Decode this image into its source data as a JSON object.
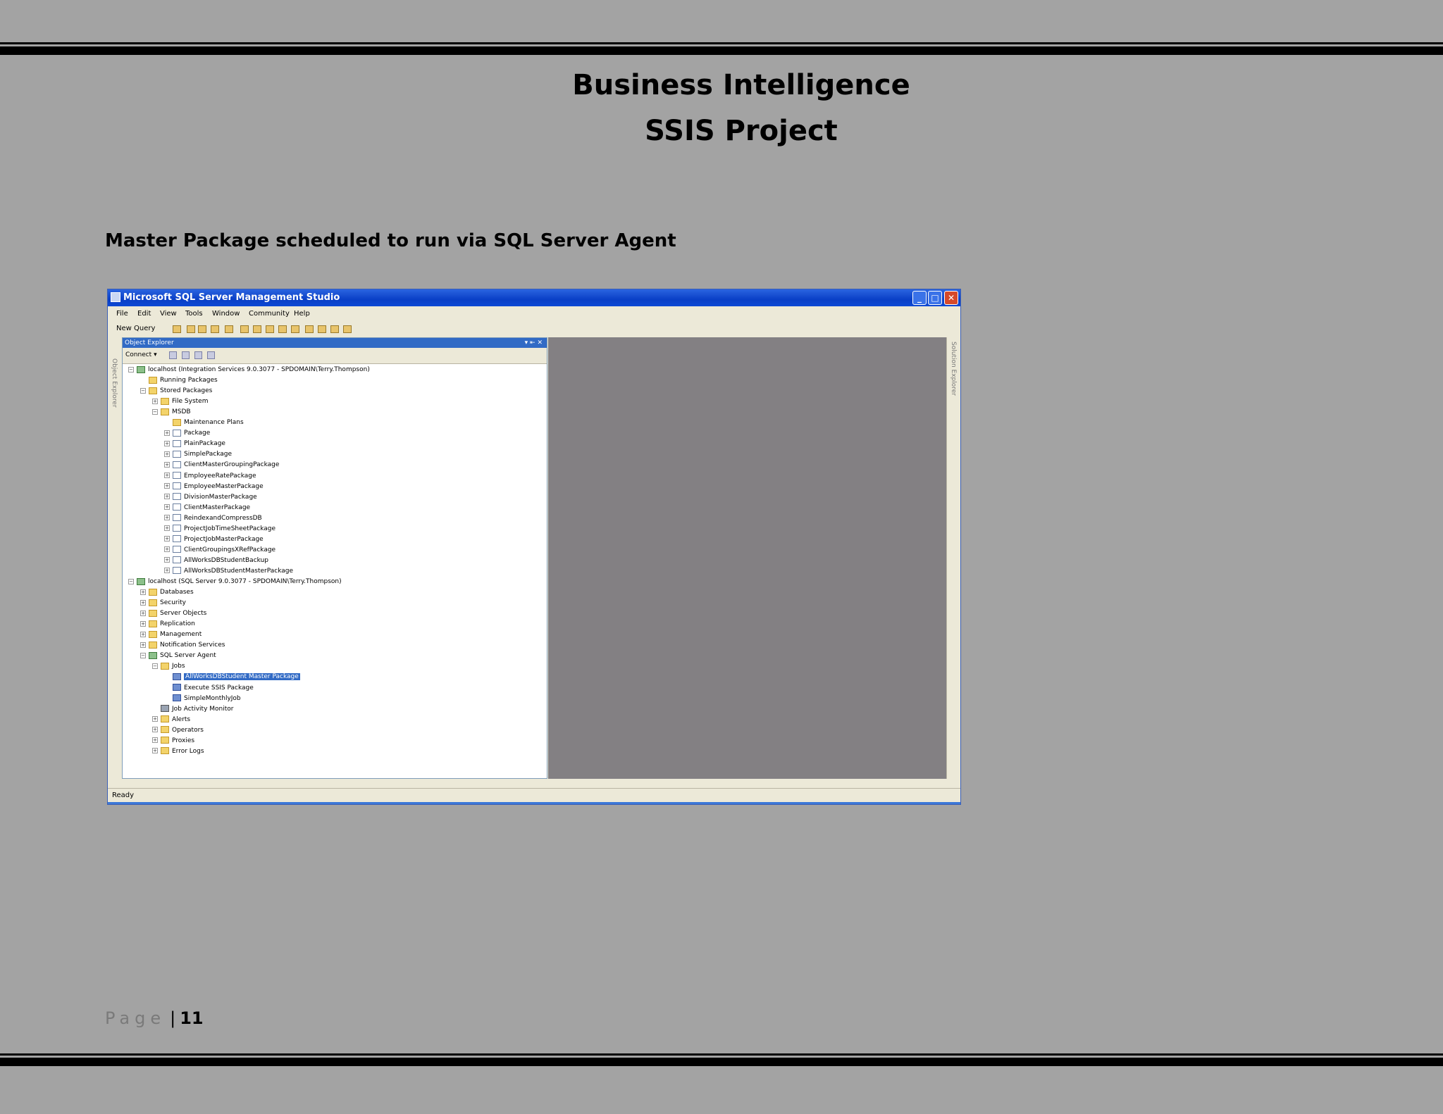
{
  "header": {
    "title_line1": "Business Intelligence",
    "title_line2": "SSIS Project"
  },
  "caption": "Master Package scheduled to run via SQL Server Agent",
  "screenshot": {
    "window_title": "Microsoft SQL Server Management Studio",
    "menu": [
      "File",
      "Edit",
      "View",
      "Tools",
      "Window",
      "Community",
      "Help"
    ],
    "toolbar_new_query": "New Query",
    "object_explorer": {
      "title": "Object Explorer",
      "connect": "Connect ▾",
      "strip_label": "Object Explorer"
    },
    "solution_explorer_label": "Solution Explorer",
    "tree": [
      {
        "label": "localhost (Integration Services 9.0.3077 - SPDOMAIN\\Terry.Thompson)",
        "icon": "server",
        "exp": "-",
        "selected": false
      },
      {
        "label": "Running Packages",
        "icon": "folder",
        "exp": "",
        "selected": false
      },
      {
        "label": "Stored Packages",
        "icon": "folder",
        "exp": "-",
        "selected": false
      },
      {
        "label": "File System",
        "icon": "folder",
        "exp": "+",
        "selected": false
      },
      {
        "label": "MSDB",
        "icon": "folder",
        "exp": "-",
        "selected": false
      },
      {
        "label": "Maintenance Plans",
        "icon": "folder",
        "exp": "",
        "selected": false
      },
      {
        "label": "Package",
        "icon": "pkg",
        "exp": "+",
        "selected": false
      },
      {
        "label": "PlainPackage",
        "icon": "pkg",
        "exp": "+",
        "selected": false
      },
      {
        "label": "SimplePackage",
        "icon": "pkg",
        "exp": "+",
        "selected": false
      },
      {
        "label": "ClientMasterGroupingPackage",
        "icon": "pkg",
        "exp": "+",
        "selected": false
      },
      {
        "label": "EmployeeRatePackage",
        "icon": "pkg",
        "exp": "+",
        "selected": false
      },
      {
        "label": "EmployeeMasterPackage",
        "icon": "pkg",
        "exp": "+",
        "selected": false
      },
      {
        "label": "DivisionMasterPackage",
        "icon": "pkg",
        "exp": "+",
        "selected": false
      },
      {
        "label": "ClientMasterPackage",
        "icon": "pkg",
        "exp": "+",
        "selected": false
      },
      {
        "label": "ReindexandCompressDB",
        "icon": "pkg",
        "exp": "+",
        "selected": false
      },
      {
        "label": "ProjectJobTimeSheetPackage",
        "icon": "pkg",
        "exp": "+",
        "selected": false
      },
      {
        "label": "ProjectJobMasterPackage",
        "icon": "pkg",
        "exp": "+",
        "selected": false
      },
      {
        "label": "ClientGroupingsXRefPackage",
        "icon": "pkg",
        "exp": "+",
        "selected": false
      },
      {
        "label": "AllWorksDBStudentBackup",
        "icon": "pkg",
        "exp": "+",
        "selected": false
      },
      {
        "label": "AllWorksDBStudentMasterPackage",
        "icon": "pkg",
        "exp": "+",
        "selected": false
      },
      {
        "label": "localhost (SQL Server 9.0.3077 - SPDOMAIN\\Terry.Thompson)",
        "icon": "server",
        "exp": "-",
        "selected": false
      },
      {
        "label": "Databases",
        "icon": "folder",
        "exp": "+",
        "selected": false
      },
      {
        "label": "Security",
        "icon": "folder",
        "exp": "+",
        "selected": false
      },
      {
        "label": "Server Objects",
        "icon": "folder",
        "exp": "+",
        "selected": false
      },
      {
        "label": "Replication",
        "icon": "folder",
        "exp": "+",
        "selected": false
      },
      {
        "label": "Management",
        "icon": "folder",
        "exp": "+",
        "selected": false
      },
      {
        "label": "Notification Services",
        "icon": "folder",
        "exp": "+",
        "selected": false
      },
      {
        "label": "SQL Server Agent",
        "icon": "server",
        "exp": "-",
        "selected": false
      },
      {
        "label": "Jobs",
        "icon": "folder",
        "exp": "-",
        "selected": false
      },
      {
        "label": "AllWorksDBStudent Master Package",
        "icon": "job",
        "exp": "",
        "selected": true
      },
      {
        "label": "Execute SSIS Package",
        "icon": "job",
        "exp": "",
        "selected": false
      },
      {
        "label": "SimpleMonthlyJob",
        "icon": "job",
        "exp": "",
        "selected": false
      },
      {
        "label": "Job Activity Monitor",
        "icon": "monitor",
        "exp": "",
        "selected": false
      },
      {
        "label": "Alerts",
        "icon": "folder",
        "exp": "+",
        "selected": false
      },
      {
        "label": "Operators",
        "icon": "folder",
        "exp": "+",
        "selected": false
      },
      {
        "label": "Proxies",
        "icon": "folder",
        "exp": "+",
        "selected": false
      },
      {
        "label": "Error Logs",
        "icon": "folder",
        "exp": "+",
        "selected": false
      }
    ],
    "status": "Ready"
  },
  "footer": {
    "page_label": "Page",
    "separator": "|",
    "page_number": "11"
  }
}
